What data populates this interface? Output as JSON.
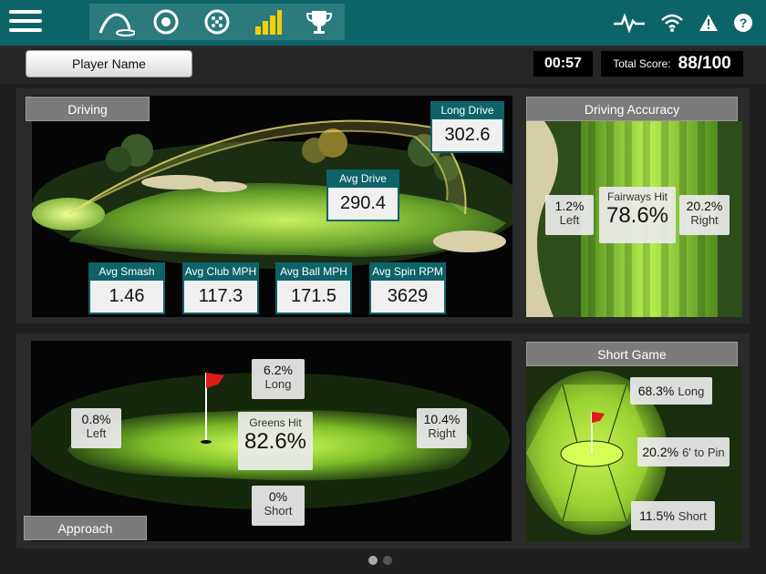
{
  "topbar": {
    "menu_icon": "hamburger-menu-icon",
    "modes": [
      {
        "name": "driving-range-mode-icon"
      },
      {
        "name": "target-mode-icon"
      },
      {
        "name": "ball-mode-icon"
      },
      {
        "name": "stats-mode-icon"
      },
      {
        "name": "trophy-mode-icon"
      }
    ],
    "status_icons": [
      "heartbeat-icon",
      "wifi-icon",
      "warning-icon",
      "help-icon"
    ],
    "colors": {
      "bar": "#0d6468",
      "modes_bg": "#2b7b7e",
      "active_mode": "#f4d000"
    }
  },
  "header": {
    "player_name": "Player Name",
    "timer": "00:57",
    "total_score_label": "Total Score:",
    "total_score": "88/100"
  },
  "driving": {
    "title": "Driving",
    "long_drive_label": "Long Drive",
    "long_drive": "302.6",
    "avg_drive_label": "Avg Drive",
    "avg_drive": "290.4",
    "stats": [
      {
        "label": "Avg Smash",
        "value": "1.46"
      },
      {
        "label": "Avg Club MPH",
        "value": "117.3"
      },
      {
        "label": "Avg Ball MPH",
        "value": "171.5"
      },
      {
        "label": "Avg Spin RPM",
        "value": "3629"
      }
    ]
  },
  "accuracy": {
    "title": "Driving Accuracy",
    "left_pct": "1.2%",
    "left_label": "Left",
    "hit_label": "Fairways Hit",
    "hit_pct": "78.6%",
    "right_pct": "20.2%",
    "right_label": "Right"
  },
  "approach": {
    "title": "Approach",
    "long_pct": "6.2%",
    "long_label": "Long",
    "left_pct": "0.8%",
    "left_label": "Left",
    "hit_label": "Greens Hit",
    "hit_pct": "82.6%",
    "right_pct": "10.4%",
    "right_label": "Right",
    "short_pct": "0%",
    "short_label": "Short"
  },
  "short_game": {
    "title": "Short Game",
    "long_pct": "68.3%",
    "long_label": "Long",
    "pin_pct": "20.2%",
    "pin_label": "6' to Pin",
    "short_pct": "11.5%",
    "short_label": "Short"
  },
  "pager": {
    "pages": 2,
    "current": 1
  }
}
